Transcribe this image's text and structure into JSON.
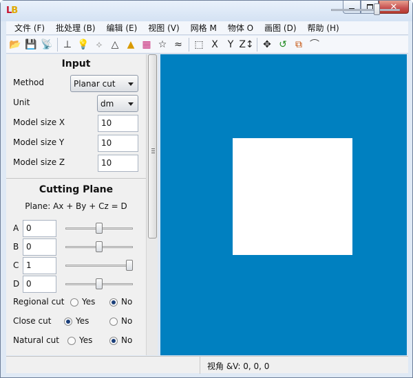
{
  "window": {
    "icon_text_a": "L",
    "icon_text_b": "B",
    "close_glyph": "✕"
  },
  "menu": [
    {
      "label": "文件 (F)"
    },
    {
      "label": "批处理 (B)"
    },
    {
      "label": "编辑 (E)"
    },
    {
      "label": "视图 (V)"
    },
    {
      "label": "网格 M"
    },
    {
      "label": "物体 O"
    },
    {
      "label": "画图 (D)"
    },
    {
      "label": "帮助 (H)"
    }
  ],
  "toolbar": {
    "groups": [
      [
        {
          "name": "open-folder-icon",
          "glyph": "📂",
          "color": "#d8a51a"
        },
        {
          "name": "save-icon",
          "glyph": "💾",
          "color": "#1f3b77"
        },
        {
          "name": "wireless-icon",
          "glyph": "📡",
          "color": "#2b8a2b"
        }
      ],
      [
        {
          "name": "axes-icon",
          "glyph": "⊥",
          "color": "#222"
        },
        {
          "name": "bulb-icon",
          "glyph": "💡",
          "color": "#e2b100"
        },
        {
          "name": "tree-wire-icon",
          "glyph": "⟡",
          "color": "#9a9a9a"
        },
        {
          "name": "triangle-mesh-icon",
          "glyph": "△",
          "color": "#333"
        },
        {
          "name": "triangle-fill-icon",
          "glyph": "▲",
          "color": "#d99a00"
        },
        {
          "name": "color-palette-icon",
          "glyph": "▦",
          "color": "#c92b7a"
        },
        {
          "name": "star-icon",
          "glyph": "☆",
          "color": "#222"
        },
        {
          "name": "curve-icon",
          "glyph": "≈",
          "color": "#222"
        }
      ],
      [
        {
          "name": "select-box-icon",
          "glyph": "⬚",
          "color": "#222"
        },
        {
          "name": "x-axis-icon",
          "glyph": "X",
          "color": "#222"
        },
        {
          "name": "y-axis-icon",
          "glyph": "Y",
          "color": "#222"
        },
        {
          "name": "z-axis-icon",
          "glyph": "Z↕",
          "color": "#222"
        }
      ],
      [
        {
          "name": "move-icon",
          "glyph": "✥",
          "color": "#222"
        },
        {
          "name": "rotate-icon",
          "glyph": "↺",
          "color": "#1e8a1e"
        },
        {
          "name": "scale-icon",
          "glyph": "⧉",
          "color": "#c24a00"
        },
        {
          "name": "bend-icon",
          "glyph": "⌒",
          "color": "#444"
        }
      ]
    ],
    "zoom_slider_fraction": 0.68
  },
  "panel": {
    "input_title": "Input",
    "method_label": "Method",
    "method_value": "Planar cut",
    "unit_label": "Unit",
    "unit_value": "dm",
    "size_x_label": "Model size X",
    "size_x_value": "10",
    "size_y_label": "Model size Y",
    "size_y_value": "10",
    "size_z_label": "Model size Z",
    "size_z_value": "10",
    "cutting_title": "Cutting Plane",
    "equation": "Plane: Ax + By + Cz = D",
    "params": [
      {
        "label": "A",
        "value": "0",
        "slider_fraction": 0.5
      },
      {
        "label": "B",
        "value": "0",
        "slider_fraction": 0.5
      },
      {
        "label": "C",
        "value": "1",
        "slider_fraction": 1.0
      },
      {
        "label": "D",
        "value": "0",
        "slider_fraction": 0.5
      }
    ],
    "regional_cut_label": "Regional cut",
    "close_cut_label": "Close cut",
    "natural_cut_label": "Natural cut",
    "yes": "Yes",
    "no": "No",
    "regional_cut_selected": "No",
    "close_cut_selected": "Yes",
    "natural_cut_selected": "No"
  },
  "viewport": {
    "background": "#0080c0",
    "model_color": "#ffffff"
  },
  "status": {
    "text": "视角 &V: 0, 0, 0"
  }
}
